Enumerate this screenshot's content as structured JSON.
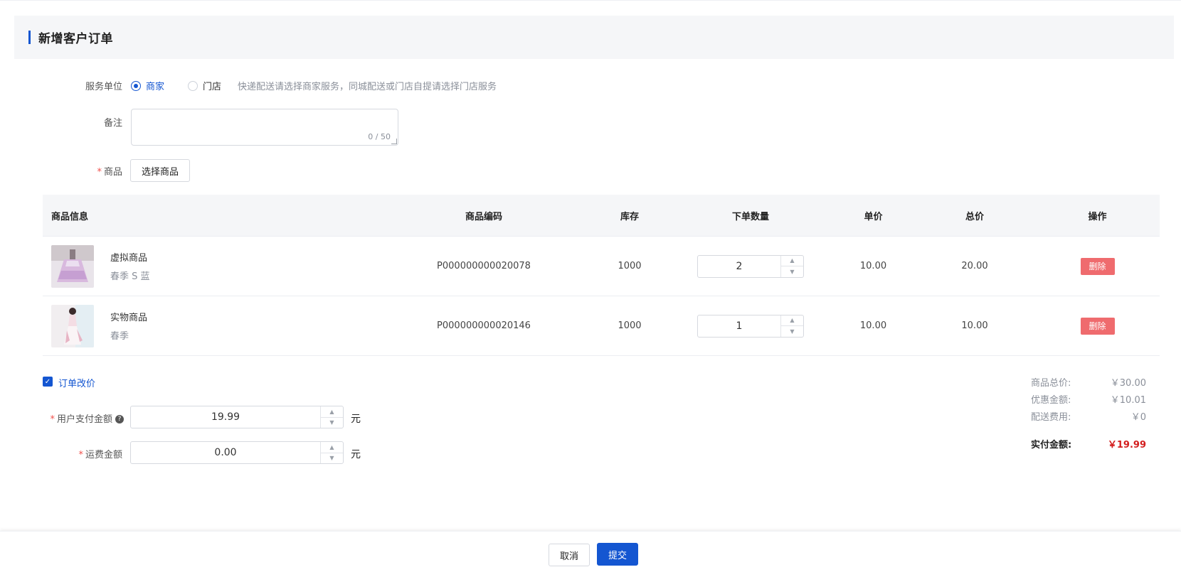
{
  "header": {
    "title": "新增客户订单"
  },
  "service_unit": {
    "label": "服务单位",
    "options": [
      {
        "label": "商家",
        "checked": true
      },
      {
        "label": "门店",
        "checked": false
      }
    ],
    "hint": "快递配送请选择商家服务，同城配送或门店自提请选择门店服务"
  },
  "remark": {
    "label": "备注",
    "value": "",
    "counter": "0 / 50"
  },
  "product": {
    "label": "商品",
    "select_button": "选择商品"
  },
  "table": {
    "headers": [
      "商品信息",
      "商品编码",
      "库存",
      "下单数量",
      "单价",
      "总价",
      "操作"
    ],
    "rows": [
      {
        "name": "虚拟商品",
        "spec": "春季 S 蓝",
        "code": "P000000000020078",
        "stock": "1000",
        "qty": "2",
        "unit_price": "10.00",
        "total": "20.00",
        "action": "删除",
        "thumb_icon": "skirt-photo"
      },
      {
        "name": "实物商品",
        "spec": "春季",
        "code": "P000000000020146",
        "stock": "1000",
        "qty": "1",
        "unit_price": "10.00",
        "total": "10.00",
        "action": "删除",
        "thumb_icon": "dress-photo"
      }
    ]
  },
  "price_change": {
    "checkbox_label": "订单改价",
    "checked": true,
    "pay_amount": {
      "label": "用户支付金额",
      "value": "19.99",
      "unit": "元",
      "help": "?"
    },
    "shipping": {
      "label": "运费金额",
      "value": "0.00",
      "unit": "元"
    }
  },
  "summary": {
    "goods_total_label": "商品总价:",
    "goods_total": "￥30.00",
    "discount_label": "优惠金额:",
    "discount": "￥10.01",
    "delivery_label": "配送费用:",
    "delivery": "￥0",
    "paid_label": "实付金额:",
    "paid": "￥19.99"
  },
  "footer": {
    "cancel": "取消",
    "submit": "提交"
  },
  "colors": {
    "primary": "#1456d1",
    "danger": "#ef6b6e",
    "price_red": "#d31e1e"
  }
}
